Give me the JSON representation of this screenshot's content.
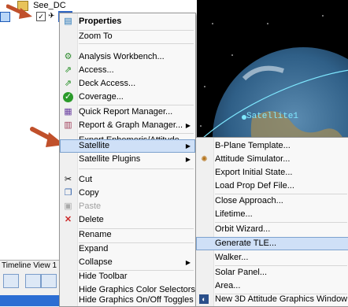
{
  "tree": {
    "parent_label": "See_DC",
    "child_label": "Sa"
  },
  "globe": {
    "satellite_label": "Satellite1"
  },
  "timeline": {
    "title": "Timeline View 1"
  },
  "context_menu": {
    "items": [
      {
        "label": "Properties",
        "icon": "properties-icon"
      },
      {
        "label": "Zoom To",
        "icon": ""
      },
      {
        "label": "Analysis Workbench...",
        "icon": "workbench-icon"
      },
      {
        "label": "Access...",
        "icon": "access-icon"
      },
      {
        "label": "Deck Access...",
        "icon": "deck-access-icon"
      },
      {
        "label": "Coverage...",
        "icon": "coverage-icon"
      },
      {
        "label": "Quick Report Manager...",
        "icon": "report-icon"
      },
      {
        "label": "Report & Graph Manager...",
        "icon": "graph-icon"
      },
      {
        "label": "Export Ephemeris/Attitude...",
        "icon": ""
      },
      {
        "label": "Satellite",
        "icon": ""
      },
      {
        "label": "Satellite Plugins",
        "icon": ""
      },
      {
        "label": "Cut",
        "icon": "cut-icon"
      },
      {
        "label": "Copy",
        "icon": "copy-icon"
      },
      {
        "label": "Paste",
        "icon": "paste-icon"
      },
      {
        "label": "Delete",
        "icon": "delete-icon"
      },
      {
        "label": "Rename",
        "icon": ""
      },
      {
        "label": "Expand",
        "icon": ""
      },
      {
        "label": "Collapse",
        "icon": ""
      },
      {
        "label": "Hide Toolbar",
        "icon": ""
      },
      {
        "label": "Hide Graphics Color Selectors",
        "icon": ""
      },
      {
        "label": "Hide Graphics On/Off Toggles",
        "icon": ""
      }
    ]
  },
  "submenu": {
    "items": [
      {
        "label": "B-Plane Template..."
      },
      {
        "label": "Attitude Simulator..."
      },
      {
        "label": "Export Initial State..."
      },
      {
        "label": "Load Prop Def File..."
      },
      {
        "label": "Close Approach..."
      },
      {
        "label": "Lifetime..."
      },
      {
        "label": "Orbit Wizard..."
      },
      {
        "label": "Generate TLE..."
      },
      {
        "label": "Walker..."
      },
      {
        "label": "Solar Panel..."
      },
      {
        "label": "Area..."
      },
      {
        "label": "New 3D Attitude Graphics Window"
      }
    ]
  },
  "colors": {
    "highlight": "#cfe0f7",
    "arrow": "#c0502b"
  }
}
